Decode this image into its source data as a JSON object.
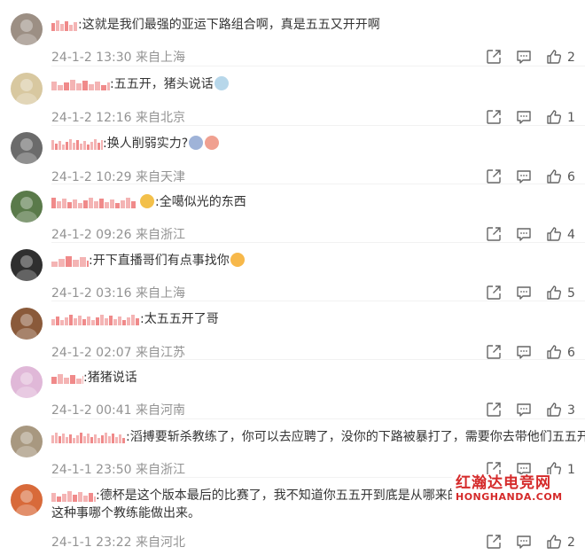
{
  "comments": [
    {
      "text": ":这就是我们最强的亚运下路组合啊，真是五五又开开啊",
      "date": "24-1-2 13:30",
      "location": "来自上海",
      "likes": "2",
      "avatar_color": "#9c8f84"
    },
    {
      "text": ":五五开，猪头说话",
      "date": "24-1-2 12:16",
      "location": "来自北京",
      "likes": "1",
      "avatar_color": "#d8c8a0"
    },
    {
      "text": ":换人削弱实力?",
      "date": "24-1-2 10:29",
      "location": "来自天津",
      "likes": "6",
      "avatar_color": "#6b6b6b"
    },
    {
      "text": ":全噶似光的东西",
      "date": "24-1-2 09:26",
      "location": "来自浙江",
      "likes": "4",
      "avatar_color": "#5a7a4a"
    },
    {
      "text": ":开下直播哥们有点事找你",
      "date": "24-1-2 03:16",
      "location": "来自上海",
      "likes": "5",
      "avatar_color": "#2f2f2f"
    },
    {
      "text": ":太五五开了哥",
      "date": "24-1-2 02:07",
      "location": "来自江苏",
      "likes": "6",
      "avatar_color": "#8a5a3a"
    },
    {
      "text": ":猪猪说话",
      "date": "24-1-2 00:41",
      "location": "来自河南",
      "likes": "3",
      "avatar_color": "#e0b8d8"
    },
    {
      "text": ":滔搏要斩杀教练了，你可以去应聘了，没你的下路被暴打了，需要你去带他们五五开",
      "date": "24-1-1 23:50",
      "location": "来自浙江",
      "likes": "1",
      "avatar_color": "#a89880"
    },
    {
      "text": ":德杯是这个版本最后的比赛了，我不知道你五五开到底是从哪来的一坨把锅全甩给选手这种事哪个教练能做出来。",
      "date": "24-1-1 23:22",
      "location": "来自河北",
      "likes": "2",
      "avatar_color": "#d86a3a"
    }
  ],
  "watermark": {
    "line1": "红瀚达电竞网",
    "line2": "HONGHANDA.COM"
  },
  "icons": {
    "share": "share-icon",
    "comment": "comment-icon",
    "like": "thumbs-up-icon"
  },
  "colors": {
    "meta": "#939393",
    "text": "#333333",
    "watermark": "#d52a2a"
  }
}
